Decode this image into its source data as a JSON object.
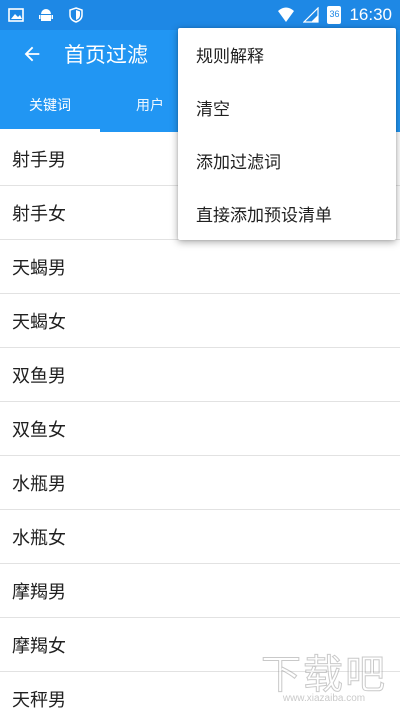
{
  "colors": {
    "primary": "#2196f3",
    "status_bar": "#1e88e5",
    "text": "#212121",
    "divider": "#e2e2e2"
  },
  "status_bar": {
    "icons_left": [
      "image-icon",
      "android-icon",
      "shield-icon"
    ],
    "icons_right": [
      "wifi-icon",
      "signal-icon",
      "battery-icon"
    ],
    "battery_level": "36",
    "time": "16:30"
  },
  "app_bar": {
    "back_icon": "arrow-left-icon",
    "title": "首页过滤"
  },
  "tabs": [
    {
      "label": "关键词",
      "active": true
    },
    {
      "label": "用户",
      "active": false
    }
  ],
  "list": {
    "items": [
      "射手男",
      "射手女",
      "天蝎男",
      "天蝎女",
      "双鱼男",
      "双鱼女",
      "水瓶男",
      "水瓶女",
      "摩羯男",
      "摩羯女",
      "天秤男"
    ]
  },
  "menu": {
    "items": [
      "规则解释",
      "清空",
      "添加过滤词",
      "直接添加预设清单"
    ]
  },
  "watermark": {
    "logo": "下载吧",
    "url": "www.xiazaiba.com"
  }
}
